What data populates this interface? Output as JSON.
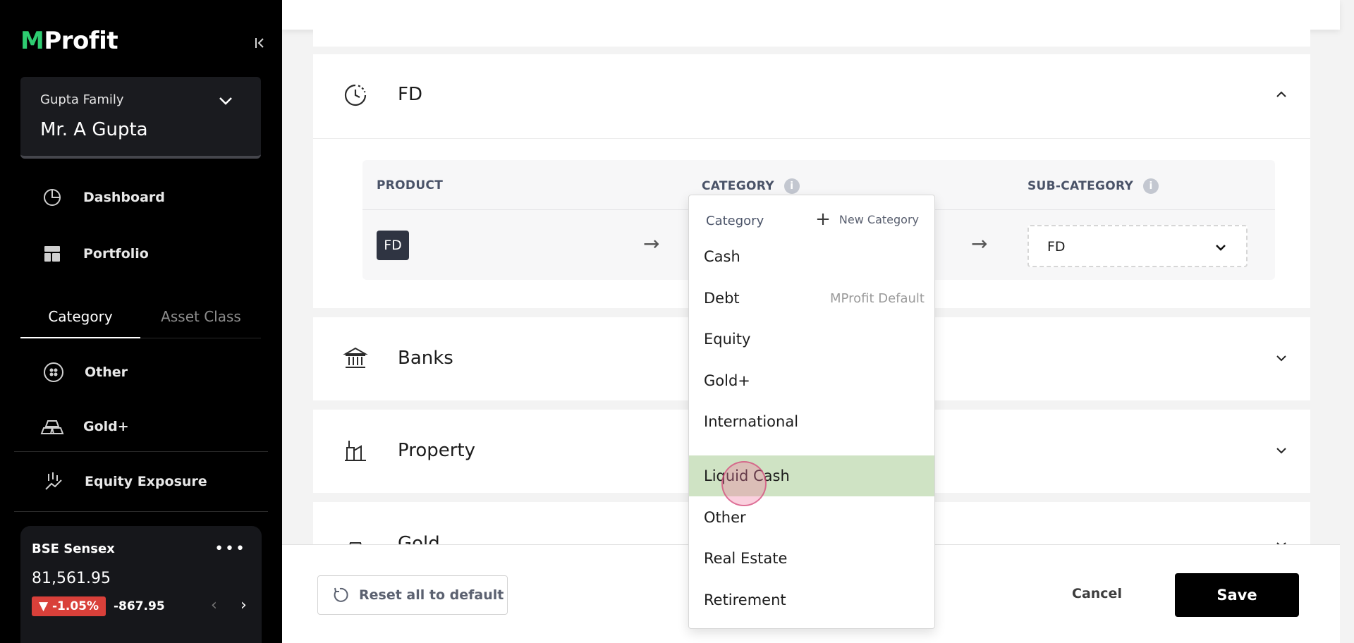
{
  "app": {
    "logo": "MProfit"
  },
  "sidebar": {
    "family": "Gupta Family",
    "member": "Mr. A Gupta",
    "nav": [
      {
        "label": "Dashboard",
        "icon": "pie-chart-icon"
      },
      {
        "label": "Portfolio",
        "icon": "grid-icon"
      }
    ],
    "tabs": {
      "active": "Category",
      "inactive": "Asset Class"
    },
    "categories": [
      {
        "label": "Other",
        "icon": "other-icon"
      },
      {
        "label": "Gold+",
        "icon": "gold-bars-icon"
      },
      {
        "label": "Equity Exposure",
        "icon": "equity-exposure-icon"
      }
    ],
    "sensex": {
      "title": "BSE Sensex",
      "value": "81,561.95",
      "change_pct": "▼ -1.05%",
      "change_abs": "-867.95",
      "colors": {
        "negative": "#d9403a"
      }
    }
  },
  "panels": {
    "fd": {
      "title": "FD"
    },
    "banks": {
      "title": "Banks"
    },
    "property": {
      "title": "Property"
    },
    "gold": {
      "title": "Gold"
    }
  },
  "table": {
    "headers": {
      "product": "PRODUCT",
      "category": "CATEGORY",
      "sub_category": "SUB-CATEGORY"
    },
    "info_glyph": "i",
    "row": {
      "product": "FD",
      "arrow": "→",
      "sub_category": "FD"
    }
  },
  "dropdown": {
    "header": "Category",
    "new_label": "New Category",
    "items": [
      {
        "label": "Cash",
        "note": ""
      },
      {
        "label": "Debt",
        "note": "MProfit Default"
      },
      {
        "label": "Equity",
        "note": ""
      },
      {
        "label": "Gold+",
        "note": ""
      },
      {
        "label": "International",
        "note": ""
      },
      {
        "label": "Liquid Cash",
        "note": ""
      },
      {
        "label": "Other",
        "note": ""
      },
      {
        "label": "Real Estate",
        "note": ""
      },
      {
        "label": "Retirement",
        "note": ""
      }
    ],
    "selected": "Liquid Cash",
    "selected_color": "#cfe3c4"
  },
  "footer": {
    "reset": "Reset all to default",
    "cancel": "Cancel",
    "save": "Save"
  }
}
